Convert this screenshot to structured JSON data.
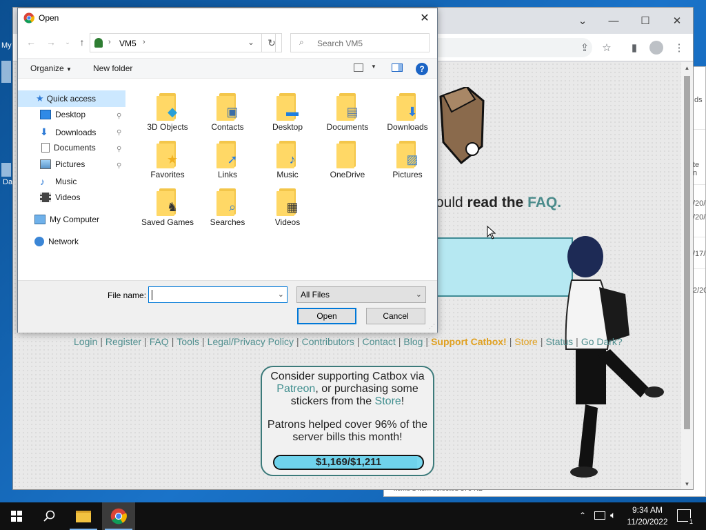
{
  "desktop": {
    "frag_my": "My",
    "frag_da": "Da"
  },
  "explorer_bg": {
    "frags": [
      "ds",
      "te n",
      "/20/",
      "/20/",
      "/17/",
      "2/20"
    ],
    "status": "items    1 item selected  379 KB"
  },
  "chrome": {
    "faq": {
      "prefix": "ould ",
      "bold": "read the",
      "link": "FAQ."
    },
    "footer_links": [
      {
        "label": "Login",
        "style": "link"
      },
      {
        "label": "Register",
        "style": "link"
      },
      {
        "label": "FAQ",
        "style": "link"
      },
      {
        "label": "Tools",
        "style": "link"
      },
      {
        "label": "Legal/Privacy Policy",
        "style": "link"
      },
      {
        "label": "Contributors",
        "style": "link"
      },
      {
        "label": "Contact",
        "style": "link"
      },
      {
        "label": "Blog",
        "style": "link"
      },
      {
        "label": "Support Catbox!",
        "style": "gold"
      },
      {
        "label": "Store",
        "style": "gold-n"
      },
      {
        "label": "Status",
        "style": "link"
      },
      {
        "label": "Go Dark?",
        "style": "link"
      }
    ],
    "support": {
      "line1": "Consider supporting Catbox via",
      "patreon": "Patreon",
      "line2": ", or purchasing some",
      "line3a": "stickers from the ",
      "store": "Store",
      "line3b": "!",
      "line4": "Patrons helped cover 96% of the",
      "line5": "server bills this month!",
      "progress_text": "$1,169/$1,211",
      "progress_fraction": 0.965
    }
  },
  "dialog": {
    "title": "Open",
    "breadcrumb": "VM5",
    "search_placeholder": "Search VM5",
    "organize": "Organize",
    "new_folder": "New folder",
    "nav_items": [
      {
        "label": "Quick access",
        "icon": "star-icon",
        "pinned": false,
        "selected": true
      },
      {
        "label": "Desktop",
        "icon": "desktop-icon",
        "pinned": true
      },
      {
        "label": "Downloads",
        "icon": "download-arrow-icon",
        "pinned": true
      },
      {
        "label": "Documents",
        "icon": "document-icon",
        "pinned": true
      },
      {
        "label": "Pictures",
        "icon": "picture-icon",
        "pinned": true
      },
      {
        "label": "Music",
        "icon": "music-note-icon",
        "pinned": false
      },
      {
        "label": "Videos",
        "icon": "film-icon",
        "pinned": false
      },
      {
        "label": "My Computer",
        "icon": "computer-icon",
        "pinned": false
      },
      {
        "label": "Network",
        "icon": "network-icon",
        "pinned": false
      }
    ],
    "files": [
      {
        "label": "3D Objects",
        "icon": "cube-icon"
      },
      {
        "label": "Contacts",
        "icon": "contact-card-icon"
      },
      {
        "label": "Desktop",
        "icon": "desktop-icon"
      },
      {
        "label": "Documents",
        "icon": "document-icon"
      },
      {
        "label": "Downloads",
        "icon": "download-arrow-icon"
      },
      {
        "label": "Favorites",
        "icon": "star-icon"
      },
      {
        "label": "Links",
        "icon": "link-arrow-icon"
      },
      {
        "label": "Music",
        "icon": "music-note-icon"
      },
      {
        "label": "OneDrive",
        "icon": "folder-icon"
      },
      {
        "label": "Pictures",
        "icon": "picture-icon"
      },
      {
        "label": "Saved Games",
        "icon": "chess-piece-icon"
      },
      {
        "label": "Searches",
        "icon": "magnifier-icon"
      },
      {
        "label": "Videos",
        "icon": "film-icon"
      }
    ],
    "file_name_label": "File name:",
    "file_name_value": "",
    "filter_value": "All Files",
    "open_button": "Open",
    "cancel_button": "Cancel"
  },
  "taskbar": {
    "time": "9:34 AM",
    "date": "11/20/2022",
    "notification_count": "1"
  },
  "colors": {
    "accent": "#0078d7",
    "link_teal": "#4a8b8b",
    "support_gold": "#e0a020",
    "upload_box": "#b6e8f2",
    "progress_fill": "#6fd3ec"
  }
}
